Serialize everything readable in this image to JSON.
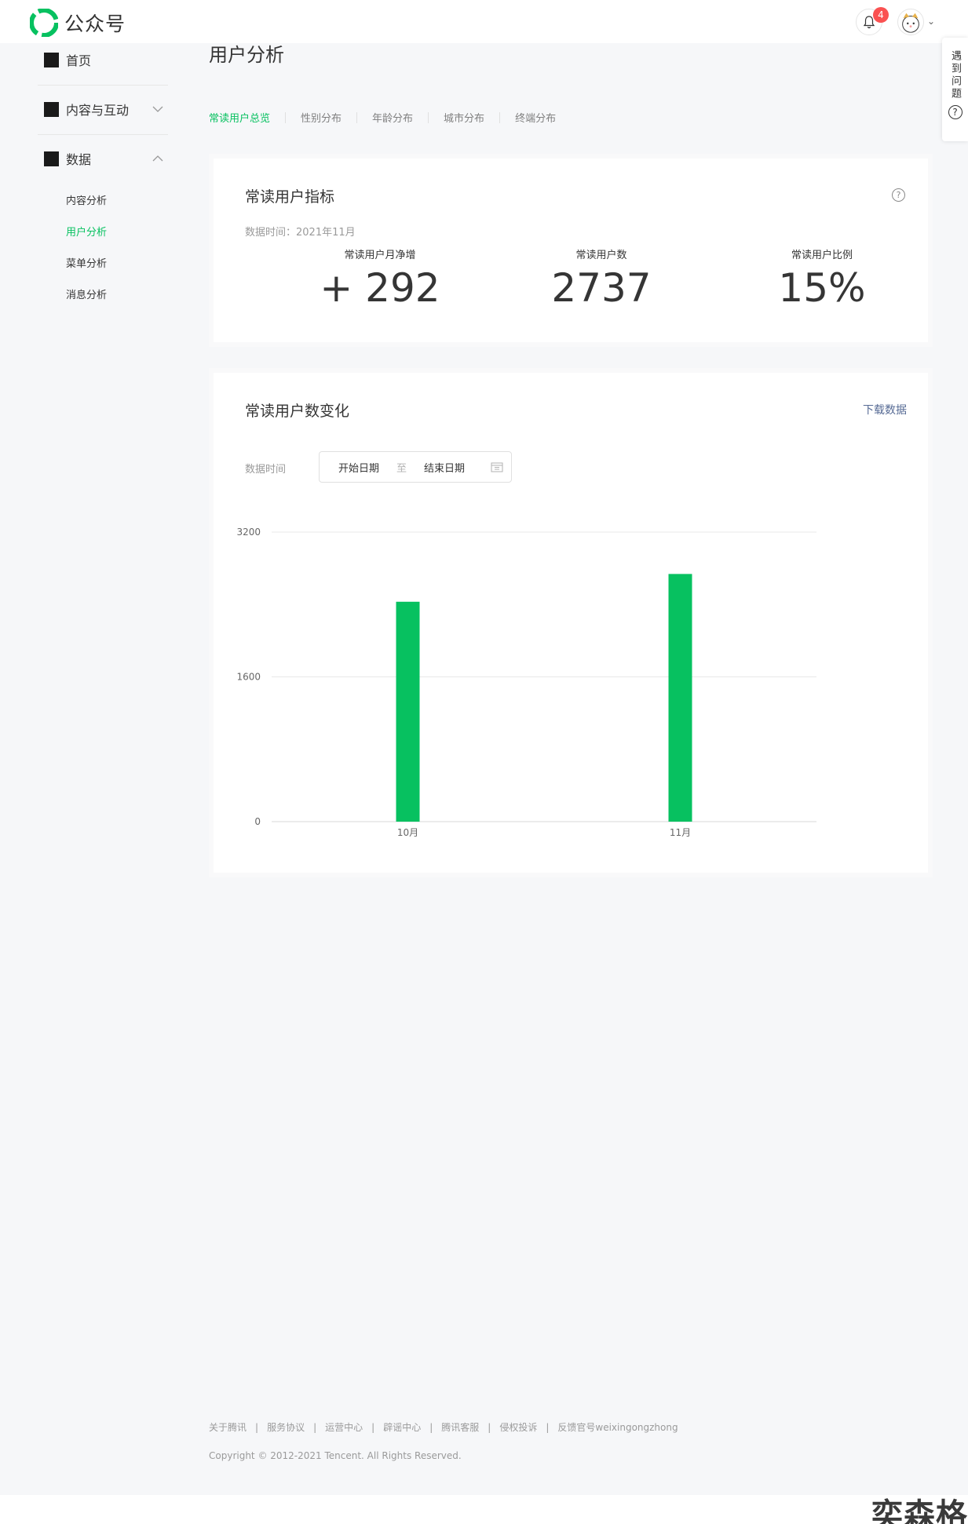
{
  "header": {
    "brand": "公众号",
    "notification_count": "4"
  },
  "help_float": {
    "label": "遇到问题",
    "icon": "?"
  },
  "sidebar": {
    "home": "首页",
    "content": "内容与互动",
    "data": "数据",
    "sub_items": [
      "内容分析",
      "用户分析",
      "菜单分析",
      "消息分析"
    ]
  },
  "page": {
    "title": "用户分析",
    "tabs": [
      "常读用户总览",
      "性别分布",
      "年龄分布",
      "城市分布",
      "终端分布"
    ]
  },
  "kpi_card": {
    "title": "常读用户指标",
    "help": "?",
    "data_time": "数据时间：2021年11月",
    "metrics": [
      {
        "label": "常读用户月净增",
        "value": "+ 292"
      },
      {
        "label": "常读用户数",
        "value": "2737"
      },
      {
        "label": "常读用户比例",
        "value": "15%"
      }
    ]
  },
  "trend_card": {
    "title": "常读用户数变化",
    "download": "下载数据",
    "range_label": "数据时间",
    "start_placeholder": "开始日期",
    "to": "至",
    "end_placeholder": "结束日期"
  },
  "chart_data": {
    "type": "bar",
    "categories": [
      "10月",
      "11月"
    ],
    "values": [
      2430,
      2737
    ],
    "title": "",
    "xlabel": "",
    "ylabel": "",
    "ylim": [
      0,
      3200
    ],
    "yticks": [
      0,
      1600,
      3200
    ],
    "grid": true,
    "bar_color": "#07c160"
  },
  "footer": {
    "links": [
      "关于腾讯",
      "服务协议",
      "运营中心",
      "辟谣中心",
      "腾讯客服",
      "侵权投诉",
      "反馈官号weixingongzhong"
    ],
    "copyright": "Copyright © 2012-2021 Tencent. All Rights Reserved."
  },
  "watermark": "奕森格",
  "colors": {
    "accent": "#07c160",
    "link": "#576b95",
    "badge": "#fa5151"
  }
}
